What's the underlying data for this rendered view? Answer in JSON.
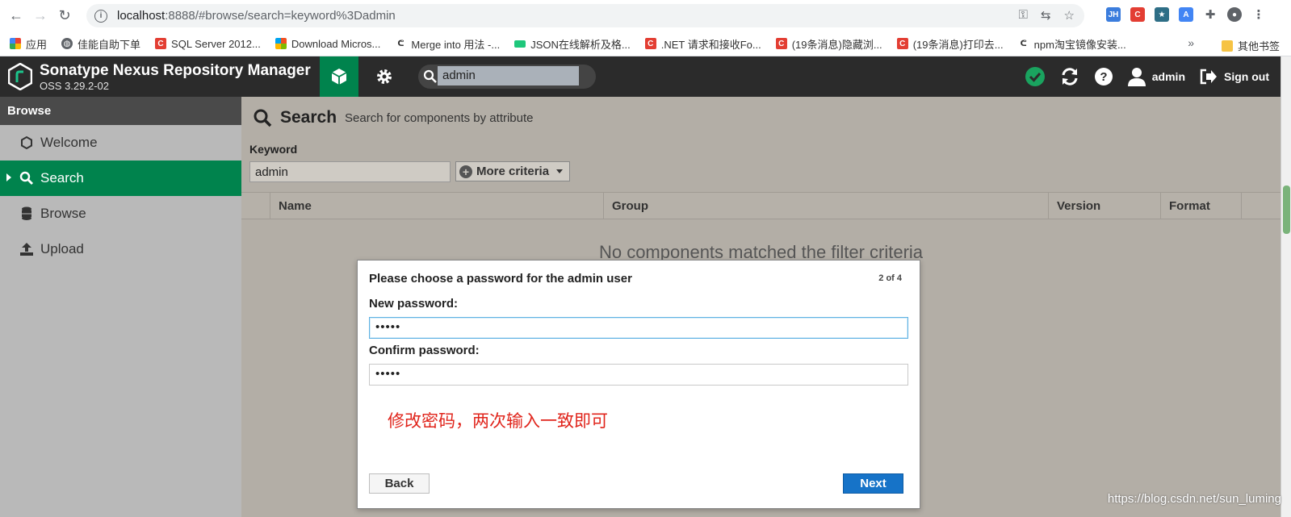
{
  "browser": {
    "url_host": "localhost",
    "url_rest": ":8888/#browse/search=keyword%3Dadmin",
    "bookmarks": [
      {
        "label": "应用",
        "icon": "apps-grid-icon",
        "color": "#d93025"
      },
      {
        "label": "佳能自助下单",
        "icon": "globe-icon",
        "color": "#5f6368"
      },
      {
        "label": "SQL Server 2012...",
        "icon": "csdn-icon",
        "color": "#e33e33"
      },
      {
        "label": "Download Micros...",
        "icon": "microsoft-icon",
        "color": "#f25022"
      },
      {
        "label": "Merge into 用法 -...",
        "icon": "bookmark-icon",
        "color": "#333333"
      },
      {
        "label": "JSON在线解析及格...",
        "icon": "json-icon",
        "color": "#1ec77b"
      },
      {
        "label": ".NET 请求和接收Fo...",
        "icon": "csdn-icon",
        "color": "#e33e33"
      },
      {
        "label": "(19条消息)隐藏浏...",
        "icon": "csdn-icon",
        "color": "#e33e33"
      },
      {
        "label": "(19条消息)打印去...",
        "icon": "csdn-icon",
        "color": "#e33e33"
      },
      {
        "label": "npm淘宝镜像安装...",
        "icon": "bookmark-icon",
        "color": "#333333"
      }
    ],
    "more_bookmarks": "»",
    "other_bookmarks": "其他书签"
  },
  "header": {
    "title": "Sonatype Nexus Repository Manager",
    "version": "OSS 3.29.2-02",
    "search_value": "admin",
    "user": "admin",
    "sign_out": "Sign out"
  },
  "sidebar": {
    "heading": "Browse",
    "items": [
      {
        "label": "Welcome",
        "icon": "hexagon-icon"
      },
      {
        "label": "Search",
        "icon": "search-icon"
      },
      {
        "label": "Browse",
        "icon": "database-icon"
      },
      {
        "label": "Upload",
        "icon": "upload-icon"
      }
    ]
  },
  "main": {
    "title": "Search",
    "subtitle": "Search for components by attribute",
    "keyword_label": "Keyword",
    "keyword_value": "admin",
    "more_criteria": "More criteria",
    "columns": [
      "Name",
      "Group",
      "Version",
      "Format"
    ],
    "empty_message": "No components matched the filter criteria"
  },
  "modal": {
    "title": "Please choose a password for the admin user",
    "step": "2 of 4",
    "new_password_label": "New password:",
    "new_password_value": "•••••",
    "confirm_password_label": "Confirm password:",
    "confirm_password_value": "•••••",
    "annotation": "修改密码，两次输入一致即可",
    "back": "Back",
    "next": "Next"
  },
  "watermark": "https://blog.csdn.net/sun_luming",
  "colors": {
    "nexus_green": "#00834d",
    "header_dark": "#2b2b2b",
    "next_blue": "#1673c8",
    "annotation_red": "#e0241b"
  }
}
